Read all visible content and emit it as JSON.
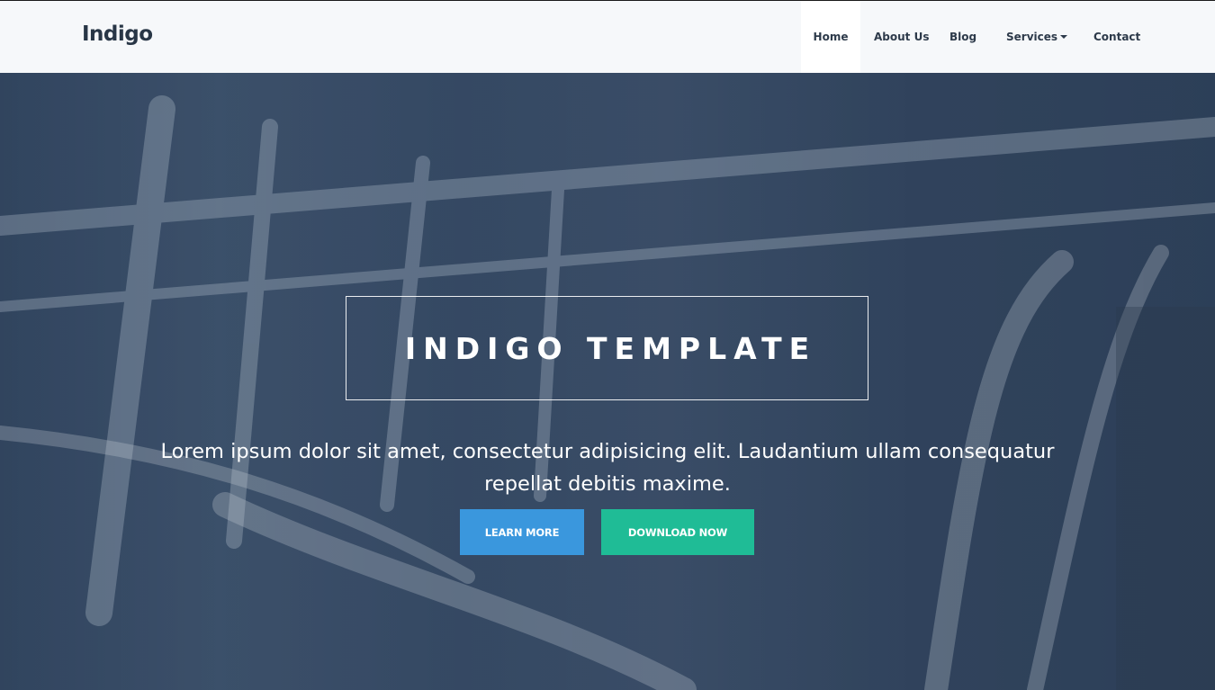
{
  "brand": "Indigo",
  "nav": {
    "home": "Home",
    "about": "About Us",
    "blog": "Blog",
    "services": "Services",
    "contact": "Contact"
  },
  "hero": {
    "title": "INDIGO TEMPLATE",
    "lead": "Lorem ipsum dolor sit amet, consectetur adipisicing elit. Laudantium ullam consequatur repellat debitis maxime.",
    "learn_more": "LEARN MORE",
    "download_now": "DOWNLOAD NOW"
  },
  "colors": {
    "navbar_bg": "#f6f8fa",
    "brand_text": "#283646",
    "learn_more_button": "#3a97dd",
    "download_button": "#1fbc96",
    "hero_overlay": "#3a4f6a"
  },
  "icons": {
    "services_dropdown": "caret-down-icon"
  }
}
